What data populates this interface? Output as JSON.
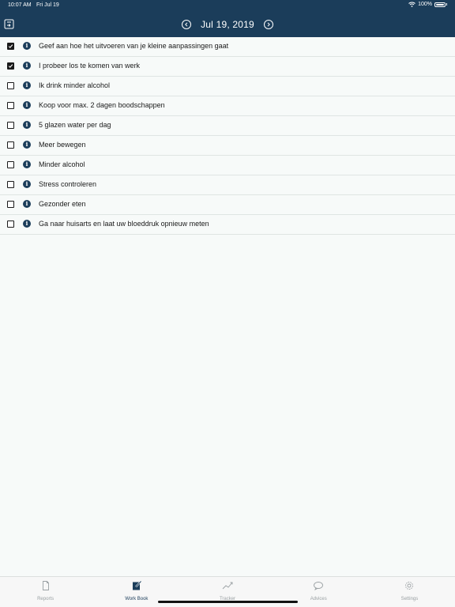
{
  "status_bar": {
    "time": "10:07 AM",
    "date": "Fri Jul 19",
    "battery": "100%"
  },
  "header": {
    "date_label": "Jul 19, 2019",
    "background_color": "#1b3d5a"
  },
  "items": [
    {
      "label": "Geef aan hoe het uitvoeren van je kleine aanpassingen gaat",
      "checked": true
    },
    {
      "label": "I probeer los te komen van werk",
      "checked": true
    },
    {
      "label": "Ik drink minder alcohol",
      "checked": false
    },
    {
      "label": "Koop voor max. 2 dagen boodschappen",
      "checked": false
    },
    {
      "label": "5 glazen water per dag",
      "checked": false
    },
    {
      "label": "Meer bewegen",
      "checked": false
    },
    {
      "label": "Minder alcohol",
      "checked": false
    },
    {
      "label": "Stress controleren",
      "checked": false
    },
    {
      "label": "Gezonder eten",
      "checked": false
    },
    {
      "label": "Ga naar huisarts en laat uw bloeddruk opnieuw meten",
      "checked": false
    }
  ],
  "tabs": [
    {
      "label": "Reports",
      "icon": "document-icon",
      "active": false
    },
    {
      "label": "Work Book",
      "icon": "notebook-pencil-icon",
      "active": true
    },
    {
      "label": "Tracker",
      "icon": "trend-chart-icon",
      "active": false
    },
    {
      "label": "Advices",
      "icon": "speech-bubble-icon",
      "active": false
    },
    {
      "label": "Settings",
      "icon": "gear-icon",
      "active": false
    }
  ]
}
